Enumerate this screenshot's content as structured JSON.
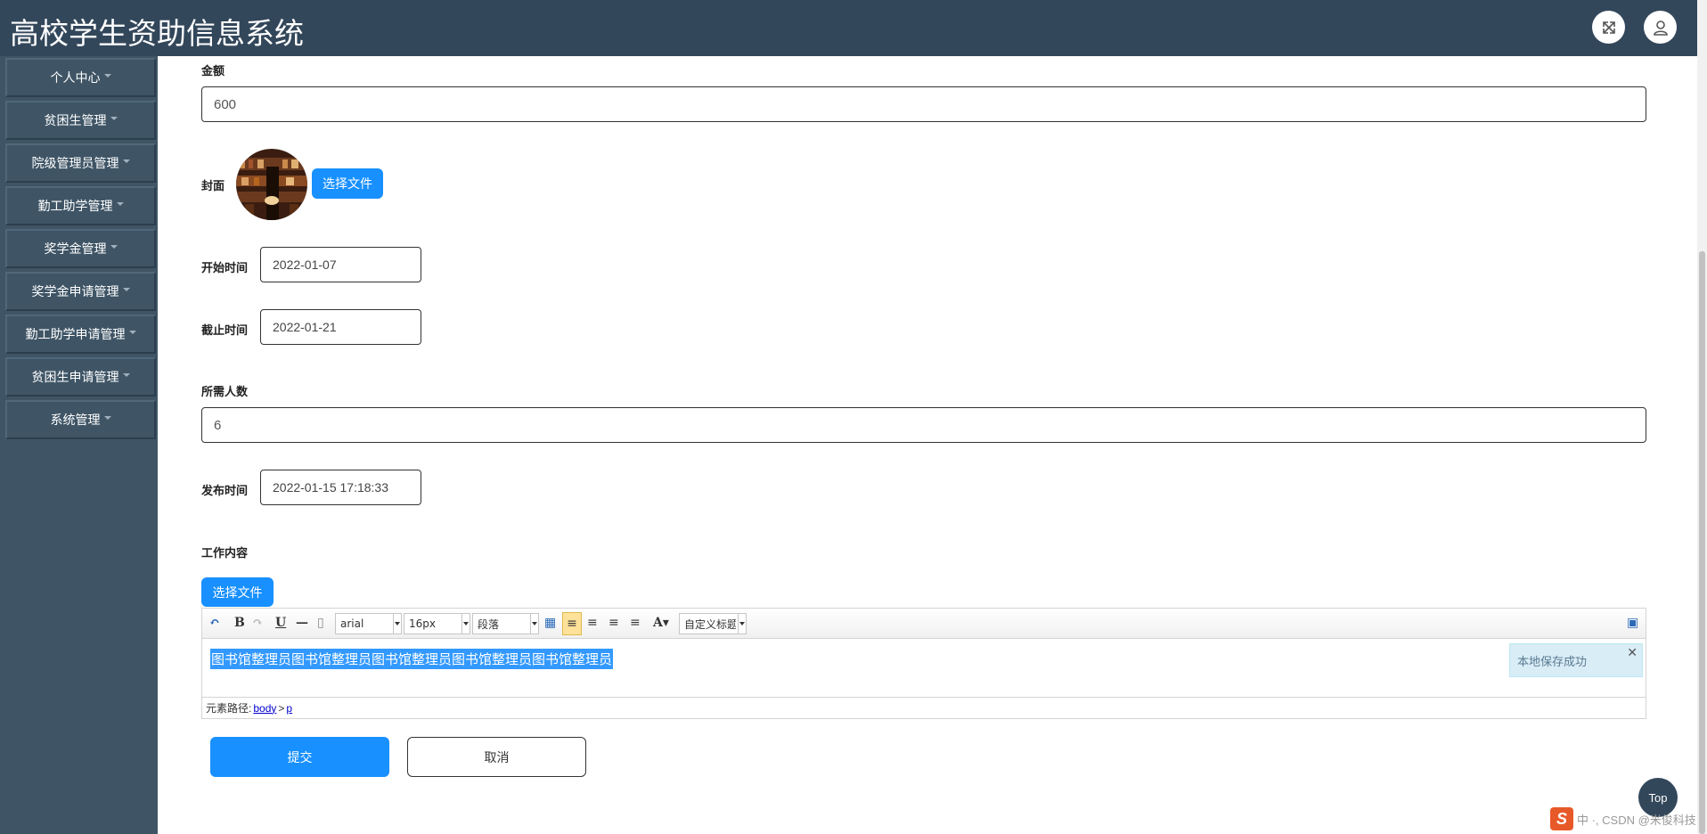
{
  "header": {
    "title": "高校学生资助信息系统",
    "icons": [
      "fullscreen-icon",
      "user-icon"
    ]
  },
  "sidebar": {
    "items": [
      {
        "label": "个人中心"
      },
      {
        "label": "贫困生管理"
      },
      {
        "label": "院级管理员管理"
      },
      {
        "label": "勤工助学管理"
      },
      {
        "label": "奖学金管理"
      },
      {
        "label": "奖学金申请管理"
      },
      {
        "label": "勤工助学申请管理"
      },
      {
        "label": "贫困生申请管理"
      },
      {
        "label": "系统管理"
      }
    ]
  },
  "form": {
    "amount_label": "金额",
    "amount_value": "600",
    "cover_label": "封面",
    "cover_button": "选择文件",
    "start_label": "开始时间",
    "start_value": "2022-01-07",
    "end_label": "截止时间",
    "end_value": "2022-01-21",
    "people_label": "所需人数",
    "people_value": "6",
    "publish_label": "发布时间",
    "publish_value": "2022-01-15 17:18:33",
    "content_label": "工作内容",
    "content_button": "选择文件"
  },
  "editor": {
    "font_family": "arial",
    "font_size": "16px",
    "paragraph": "段落",
    "custom_title": "自定义标题",
    "content_text": "图书馆整理员图书馆整理员图书馆整理员图书馆整理员图书馆整理员",
    "toast_text": "本地保存成功",
    "toast_close": "✕",
    "path_label": "元素路径:",
    "path_body": "body",
    "path_sep": ">",
    "path_p": "p"
  },
  "actions": {
    "submit": "提交",
    "cancel": "取消"
  },
  "floating": {
    "top_button": "Top",
    "ime_text": "中 ·, CSDN @米俊科技"
  },
  "colors": {
    "header_bg": "#33475b",
    "sidebar_bg": "#3f5566",
    "primary": "#1890ff"
  }
}
